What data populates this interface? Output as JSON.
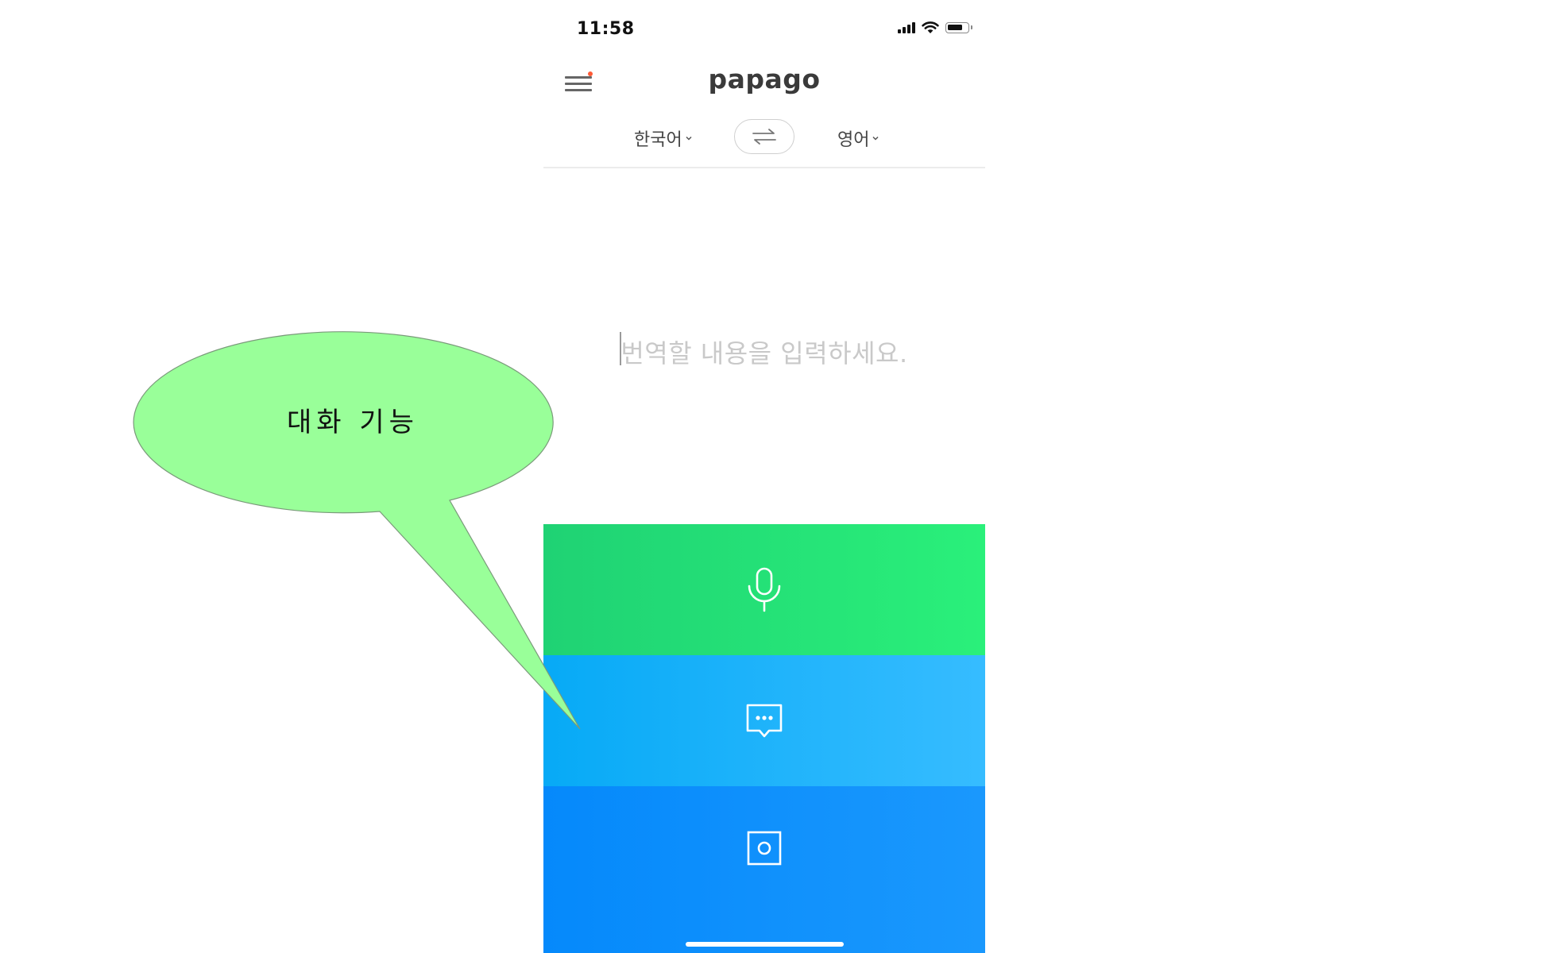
{
  "status_bar": {
    "time": "11:58"
  },
  "header": {
    "app_title": "papago",
    "menu_icon": "hamburger-menu-icon",
    "notification_dot_color": "#ff5a36"
  },
  "language_bar": {
    "source_language": "한국어",
    "target_language": "영어",
    "swap_icon": "swap-arrows-icon"
  },
  "input": {
    "placeholder": "번역할 내용을 입력하세요."
  },
  "actions": [
    {
      "name": "voice",
      "icon": "microphone-icon",
      "color": "#23e07a"
    },
    {
      "name": "conversation",
      "icon": "chat-bubble-icon",
      "color": "#12b2f8"
    },
    {
      "name": "image",
      "icon": "camera-icon",
      "color": "#0a8ffc"
    }
  ],
  "annotation": {
    "callout_text": "대화 기능",
    "callout_color": "#99ff99"
  }
}
